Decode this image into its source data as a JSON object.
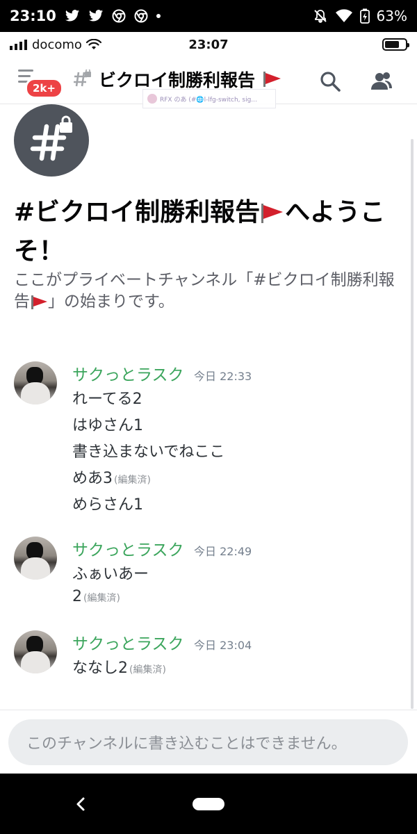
{
  "android_status": {
    "time": "23:10",
    "battery": "63%"
  },
  "ios_status": {
    "carrier": "docomo",
    "time": "23:07"
  },
  "header": {
    "badge": "2k+",
    "channel_name": "ビクロイ制勝利報告",
    "overlay_text": "RFX のあ (#🌐l-lfg-switch, sig..."
  },
  "intro": {
    "title_a": "#ビクロイ制勝利報告",
    "title_b": "へようこそ！",
    "sub_a": "ここがプライベートチャンネル「#ビクロイ制勝利報告",
    "sub_b": "」の始まりです。"
  },
  "messages": [
    {
      "author": "サクっとラスク",
      "timestamp": "今日 22:33",
      "lines": [
        {
          "text": "れーてる2",
          "edited": ""
        },
        {
          "text": "はゆさん1",
          "edited": ""
        },
        {
          "text": "書き込まないでねここ",
          "edited": ""
        },
        {
          "text": "めあ3",
          "edited": "(編集済)"
        },
        {
          "text": "めらさん1",
          "edited": ""
        }
      ]
    },
    {
      "author": "サクっとラスク",
      "timestamp": "今日 22:49",
      "lines": [
        {
          "text": "ふぁいあー",
          "edited": ""
        },
        {
          "text": "2",
          "edited": "(編集済)"
        }
      ]
    },
    {
      "author": "サクっとラスク",
      "timestamp": "今日 23:04",
      "lines": [
        {
          "text": "ななし2",
          "edited": "(編集済)"
        }
      ]
    }
  ],
  "input": {
    "placeholder": "このチャンネルに書き込むことはできません。"
  },
  "colors": {
    "author": "#3ba55c",
    "badge": "#ed4245",
    "flag": "#d3202c"
  },
  "icons": [
    "hamburger-menu-icon",
    "hash-lock-icon",
    "search-icon",
    "members-icon",
    "back-icon",
    "flag-icon"
  ]
}
